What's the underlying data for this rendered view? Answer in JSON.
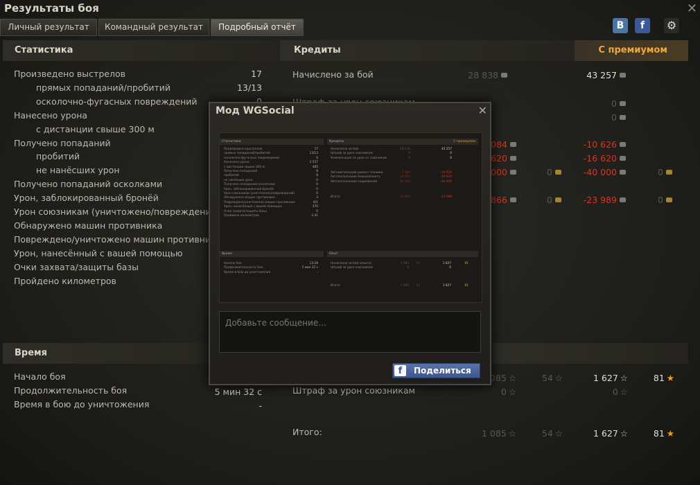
{
  "window": {
    "title": "Результаты боя"
  },
  "tabs": [
    {
      "label": "Личный результат"
    },
    {
      "label": "Командный результат"
    },
    {
      "label": "Подробный отчёт"
    }
  ],
  "social": {
    "vk": "B",
    "fb": "f",
    "settings": "⚙"
  },
  "stats": {
    "header": "Статистика",
    "rows": [
      {
        "label": "Произведено выстрелов",
        "value": "17"
      },
      {
        "label": "прямых попаданий/пробитий",
        "value": "13/13"
      },
      {
        "label": "осколочно-фугасных повреждений",
        "value": "0"
      },
      {
        "label": "Нанесено урона",
        "value": ""
      },
      {
        "label": "с дистанции свыше 300 м",
        "value": ""
      },
      {
        "label": "Получено попаданий",
        "value": ""
      },
      {
        "label": "пробитий",
        "value": ""
      },
      {
        "label": "не нанёсших урон",
        "value": ""
      },
      {
        "label": "Получено попаданий осколками",
        "value": ""
      },
      {
        "label": "Урон, заблокированный бронёй",
        "value": ""
      },
      {
        "label": "Урон союзникам (уничтожено/повреждений)",
        "value": ""
      },
      {
        "label": "Обнаружено машин противника",
        "value": ""
      },
      {
        "label": "Повреждено/уничтожено машин противника",
        "value": ""
      },
      {
        "label": "Урон, нанесённый с вашей помощью",
        "value": ""
      },
      {
        "label": "Очки захвата/защиты базы",
        "value": ""
      },
      {
        "label": "Пройдено километров",
        "value": ""
      }
    ]
  },
  "credits": {
    "header": "Кредиты",
    "premium_header": "С премиумом",
    "earned_label": "Начислено за бой",
    "earned_base": "28 838",
    "earned_prem": "43 257",
    "fine_label": "Штраф за урон союзникам",
    "fine_prem": "0",
    "compensation_prem": "0",
    "repair_prem": "-10 626",
    "repair_base": "-7 084",
    "ammo_prem": "-16 620",
    "ammo_base": "-16 620",
    "equip_prem": "-40 000",
    "equip_base": "-40 000",
    "gold_zero": "0",
    "total_prem": "-23 989",
    "total_base": "-34 866"
  },
  "time": {
    "header": "Время",
    "rows": [
      {
        "label": "Начало боя",
        "value": ""
      },
      {
        "label": "Продолжительность боя",
        "value": "5 мин 32 с"
      },
      {
        "label": "Время в бою до уничтожения",
        "value": "-"
      }
    ]
  },
  "xp": {
    "earned_base": "1 085",
    "earned_base_free": "54",
    "earned_prem": "1 627",
    "earned_prem_free": "81",
    "fine_label": "Штраф за урон союзникам",
    "fine_base": "0",
    "fine_prem": "0",
    "total_label": "Итого:",
    "total_base": "1 085",
    "total_base_free": "54",
    "total_prem": "1 627",
    "total_prem_free": "81"
  },
  "modal": {
    "title": "Мод WGSocial",
    "message_placeholder": "Добавьте сообщение...",
    "share_label": "Поделиться",
    "preview": {
      "stats_header": "Статистика",
      "credits_header": "Кредиты",
      "premium_header": "С премиумом",
      "time_header": "Время",
      "xp_header": "Опыт",
      "stats_rows": [
        {
          "l": "Произведено выстрелов",
          "v": "17"
        },
        {
          "l": "прямых попаданий/пробитий",
          "v": "13/13"
        },
        {
          "l": "осколочно-фугасных повреждений",
          "v": "0"
        },
        {
          "l": "Нанесено урона",
          "v": "2 557"
        },
        {
          "l": "с дистанции свыше 300 м",
          "v": "485"
        },
        {
          "l": "Получено попаданий",
          "v": "8"
        },
        {
          "l": "пробитий",
          "v": "8"
        },
        {
          "l": "не нанёсших урон",
          "v": "0"
        },
        {
          "l": "Получено попаданий осколками",
          "v": "0"
        },
        {
          "l": "Урон, заблокированный бронёй",
          "v": "0"
        },
        {
          "l": "Урон союзникам (уничтожено/повреждений)",
          "v": "0"
        },
        {
          "l": "Обнаружено машин противника",
          "v": "3"
        },
        {
          "l": "Повреждено/уничтожено машин противника",
          "v": "6/1"
        },
        {
          "l": "Урон, нанесённый с вашей помощью",
          "v": "370"
        },
        {
          "l": "Очки захвата/защиты базы",
          "v": "0"
        },
        {
          "l": "Пройдено километров",
          "v": "2.41"
        }
      ],
      "credit_rows": [
        {
          "l": "Начислено за бой",
          "v": "28 838",
          "p": "43 257"
        },
        {
          "l": "Штраф за урон союзникам",
          "v": "0",
          "p": "0"
        },
        {
          "l": "Компенсация за урон от союзников",
          "v": "0",
          "p": "0"
        },
        {
          "l": "Автоматический ремонт техники",
          "v": "-7 084",
          "p": "-10 626"
        },
        {
          "l": "Автопополнение боекомплекта",
          "v": "-16 620",
          "p": "-16 620"
        },
        {
          "l": "Автопополнение снаряжения",
          "v": "-40 000",
          "p": "-40 000"
        },
        {
          "l": "Итого:",
          "v": "-34 866",
          "p": "-23 989"
        }
      ],
      "time_rows": [
        {
          "l": "Начало боя",
          "v": "13:28"
        },
        {
          "l": "Продолжительность боя",
          "v": "5 мин 32 с"
        },
        {
          "l": "Время в бою до уничтожения",
          "v": "-"
        }
      ],
      "xp_rows": [
        {
          "l": "Начислено за бой (опыта)",
          "v": "1 085",
          "f": "54",
          "p": "1 627",
          "pf": "81"
        },
        {
          "l": "Штраф за урон союзникам",
          "v": "0",
          "f": "",
          "p": "0",
          "pf": ""
        },
        {
          "l": "Итого:",
          "v": "1 085",
          "f": "54",
          "p": "1 627",
          "pf": "81"
        }
      ]
    }
  },
  "colors": {
    "premium": "#f0a838",
    "negative": "#e0321e",
    "facebook": "#3b5998",
    "vk": "#4c75a3"
  }
}
